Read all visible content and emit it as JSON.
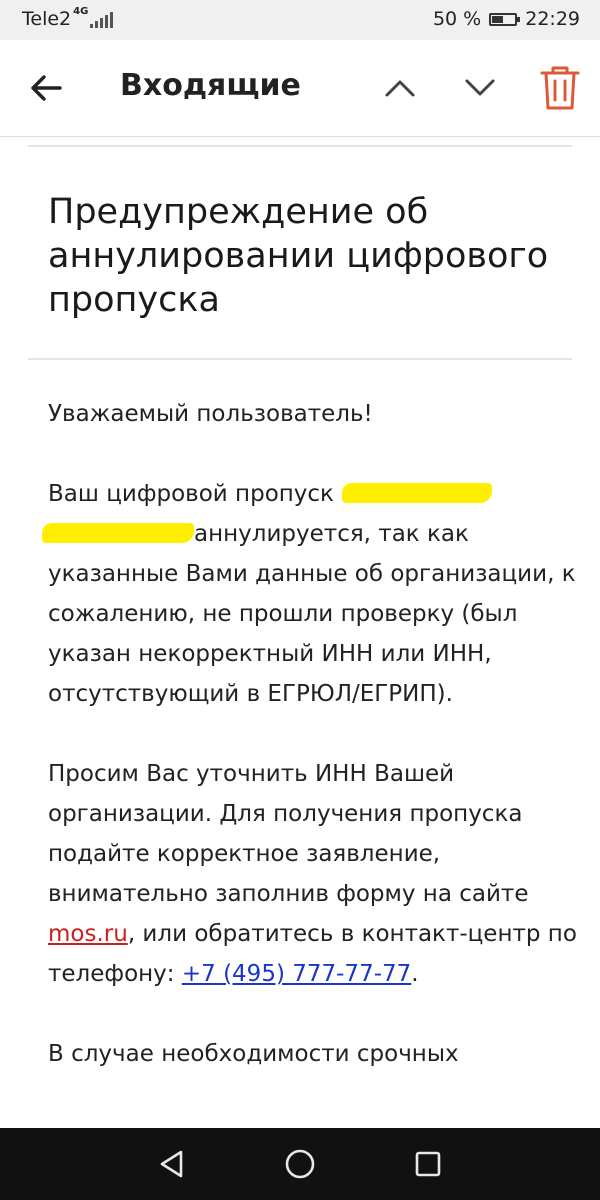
{
  "status_bar": {
    "carrier": "Tele2",
    "network": "4G",
    "battery_percent": "50 %",
    "battery_level": 0.5,
    "time": "22:29"
  },
  "app_bar": {
    "title": "Входящие",
    "icons": [
      "back-arrow-icon",
      "chevron-up-icon",
      "chevron-down-icon",
      "trash-icon"
    ],
    "trash_color": "#e0573a"
  },
  "email": {
    "subject": "Предупреждение об аннулировании цифрового пропуска",
    "greeting": "Уважаемый пользователь!",
    "paragraph1": {
      "before_redaction": "Ваш цифровой пропуск",
      "after_redaction": "аннулируется, так как указанные Вами данные об организации, к сожалению, не прошли проверку (был указан некорректный ИНН или ИНН, отсутствующий в ЕГРЮЛ/ЕГРИП)."
    },
    "paragraph2": {
      "text_before_link": "Просим Вас уточнить ИНН Вашей организации. Для получения пропуска подайте корректное заявление, внимательно заполнив форму на сайте ",
      "site_link": "mos.ru",
      "text_after_link": ", или обратитесь в контакт-центр по телефону: ",
      "phone_link": "+7 (495) 777-77-77",
      "end": "."
    },
    "paragraph3_partial": "В случае необходимости срочных"
  },
  "colors": {
    "redaction": "#ffee00",
    "site_link": "#cc1f1f",
    "phone_link": "#1a35c9"
  },
  "system_nav": {
    "icons": [
      "back-triangle-icon",
      "home-circle-icon",
      "recents-square-icon"
    ]
  }
}
